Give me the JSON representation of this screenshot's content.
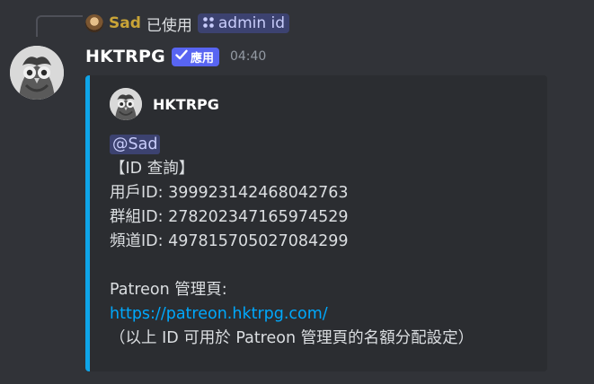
{
  "reply": {
    "username": "Sad",
    "used_text": "已使用",
    "command_label": "admin id",
    "user_color": "#c9a437"
  },
  "message": {
    "username": "HKTRPG",
    "app_badge_label": "應用",
    "timestamp": "04:40"
  },
  "embed": {
    "accent_color": "#0ea5e9",
    "author_name": "HKTRPG",
    "mention": "@Sad",
    "title_line": "【ID 查詢】",
    "user_id_line": "用戶ID: 399923142468042763",
    "group_id_line": "群組ID: 278202347165974529",
    "channel_id_line": "頻道ID: 497815705027084299",
    "patreon_label": "Patreon 管理頁:",
    "patreon_link": "https://patreon.hktrpg.com/",
    "footnote": "（以上 ID 可用於 Patreon 管理頁的名額分配設定）"
  },
  "icons": {
    "command": "slash-command-icon",
    "badge_check": "checkmark-icon",
    "avatar": "owl-avatar"
  }
}
